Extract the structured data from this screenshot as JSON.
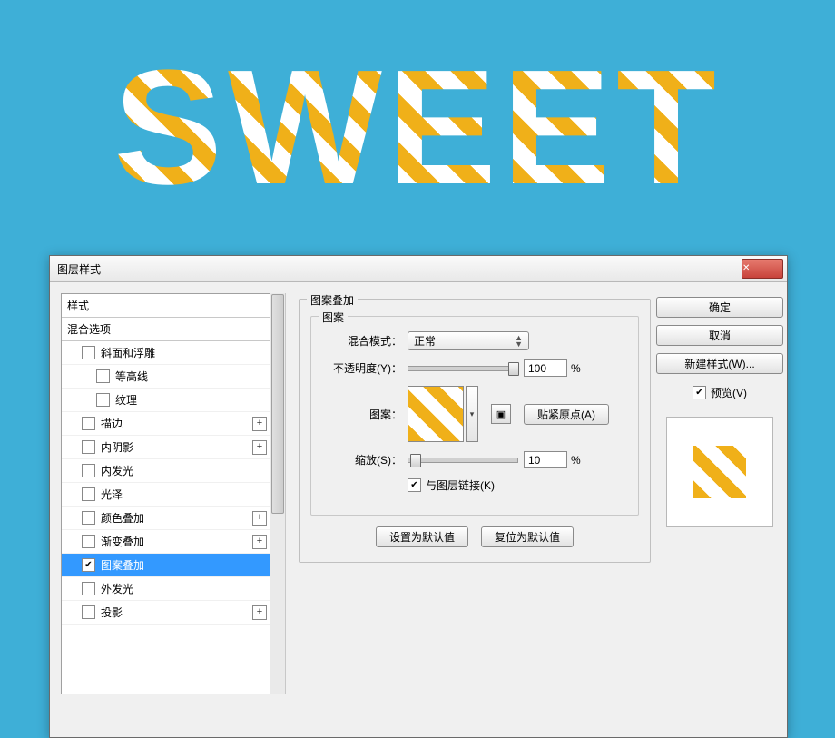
{
  "canvas": {
    "text": "SWEET"
  },
  "dialog": {
    "title": "图层样式",
    "left": {
      "header_styles": "样式",
      "header_blend": "混合选项",
      "items": [
        {
          "label": "斜面和浮雕",
          "plus": false
        },
        {
          "label": "等高线",
          "sub": true
        },
        {
          "label": "纹理",
          "sub": true
        },
        {
          "label": "描边",
          "plus": true
        },
        {
          "label": "内阴影",
          "plus": true
        },
        {
          "label": "内发光"
        },
        {
          "label": "光泽"
        },
        {
          "label": "颜色叠加",
          "plus": true
        },
        {
          "label": "渐变叠加",
          "plus": true
        },
        {
          "label": "图案叠加",
          "selected": true
        },
        {
          "label": "外发光"
        },
        {
          "label": "投影",
          "plus": true
        }
      ]
    },
    "center": {
      "section_title": "图案叠加",
      "group_title": "图案",
      "blend_mode_label": "混合模式：",
      "blend_mode_value": "正常",
      "opacity_label": "不透明度(Y)：",
      "opacity_value": "100",
      "pattern_label": "图案：",
      "snap_label": "贴紧原点(A)",
      "scale_label": "缩放(S)：",
      "scale_value": "10",
      "percent": "%",
      "link_label": "与图层链接(K)",
      "link_checked": true,
      "set_default": "设置为默认值",
      "reset_default": "复位为默认值"
    },
    "right": {
      "ok": "确定",
      "cancel": "取消",
      "new_style": "新建样式(W)...",
      "preview_label": "预览(V)",
      "preview_checked": true
    }
  }
}
